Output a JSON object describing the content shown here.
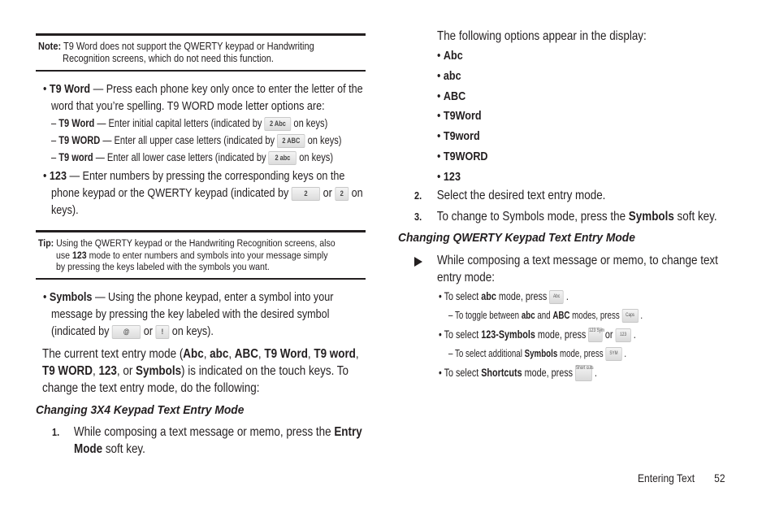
{
  "note": {
    "label": "Note:",
    "line1": "T9 Word does not support the QWERTY keypad or Handwriting",
    "line2": "Recognition screens, which do not need this function."
  },
  "t9word_bullet": {
    "term": "T9 Word",
    "line1": " — Press each phone key only once to enter the letter of the",
    "line2": "word that you’re spelling. T9 WORD mode letter options are:",
    "options": [
      {
        "term": "T9 Word",
        "text": " — Enter initial capital letters (indicated by",
        "key": "2 Abc",
        "after": "on keys)"
      },
      {
        "term": "T9 WORD",
        "text": " — Enter all upper case letters (indicated by",
        "key": "2 ABC",
        "after": "on keys)"
      },
      {
        "term": "T9 word",
        "text": " — Enter all lower case letters (indicated by",
        "key": "2 abc",
        "after": "on keys)"
      }
    ]
  },
  "num_bullet": {
    "term": "123",
    "line1": " — Enter numbers by pressing the corresponding keys on the",
    "line2": "phone keypad or the QWERTY keypad (indicated by",
    "key1": "2",
    "or": "or",
    "key2": "2",
    "after": "on",
    "line3": "keys)."
  },
  "tip": {
    "label": "Tip:",
    "line1": "Using the QWERTY keypad or the Handwriting Recognition screens, also",
    "line2_pre": "use ",
    "line2_bold": "123",
    "line2_post": " mode to enter numbers and symbols into your message simply",
    "line3": "by pressing the keys labeled with the symbols you want."
  },
  "symbols_bullet": {
    "term": "Symbols",
    "line1": " — Using the phone keypad, enter a symbol into your",
    "line2": "message by pressing the key labeled with the desired symbol",
    "line3_pre": "(indicated by",
    "key1": "@",
    "or": "or",
    "key2": "!",
    "after": "on keys)."
  },
  "current_mode": {
    "p1": "The current text entry mode (",
    "modes": [
      "Abc",
      "abc",
      "ABC",
      "T9 Word",
      "T9 word",
      "T9 WORD",
      "123",
      "Symbols"
    ],
    "sep": ", ",
    "or": ", or ",
    "p2": ") is indicated on the touch keys. To",
    "line3": "change the text entry mode, do the following:"
  },
  "section_3x4": {
    "heading": "Changing 3X4 Keypad Text Entry Mode",
    "step1_num": "1.",
    "step1_pre": "While composing a text message or memo, press the ",
    "step1_bold1": "Entry",
    "step1_bold2": "Mode",
    "step1_post": " soft key."
  },
  "right_col": {
    "intro": "The following options appear in the display:",
    "options": [
      "Abc",
      "abc",
      "ABC",
      "T9Word",
      "T9word",
      "T9WORD",
      "123"
    ],
    "step2_num": "2.",
    "step2": "Select the desired text entry mode.",
    "step3_num": "3.",
    "step3_pre": "To change to Symbols mode, press the ",
    "step3_bold": "Symbols",
    "step3_post": " soft key."
  },
  "section_qwerty": {
    "heading": "Changing QWERTY Keypad Text Entry Mode",
    "arrow_icon": "triangle-right",
    "intro_line1": "While composing a text message or memo, to change text",
    "intro_line2": "entry mode:",
    "items": [
      {
        "pre": "To select ",
        "bold": "abc",
        "post": " mode, press",
        "key": "Abc",
        "end": "."
      },
      {
        "pre": "To toggle between ",
        "bold": "abc",
        "mid": " and ",
        "bold2": "ABC",
        "post": " modes, press",
        "key": "Caps",
        "end": "."
      },
      {
        "pre": "To select ",
        "bold": "123-Symbols",
        "post": " mode, press",
        "key": "123 Sym",
        "or": "or",
        "key2": "123",
        "end": "."
      },
      {
        "pre": "To select additional ",
        "bold": "Symbols",
        "post": " mode, press",
        "key": "SYM",
        "end": "."
      },
      {
        "pre": "To select ",
        "bold": "Shortcuts",
        "post": " mode, press",
        "key": "Short cuts",
        "end": "."
      }
    ]
  },
  "footer": {
    "section": "Entering Text",
    "page": "52"
  }
}
